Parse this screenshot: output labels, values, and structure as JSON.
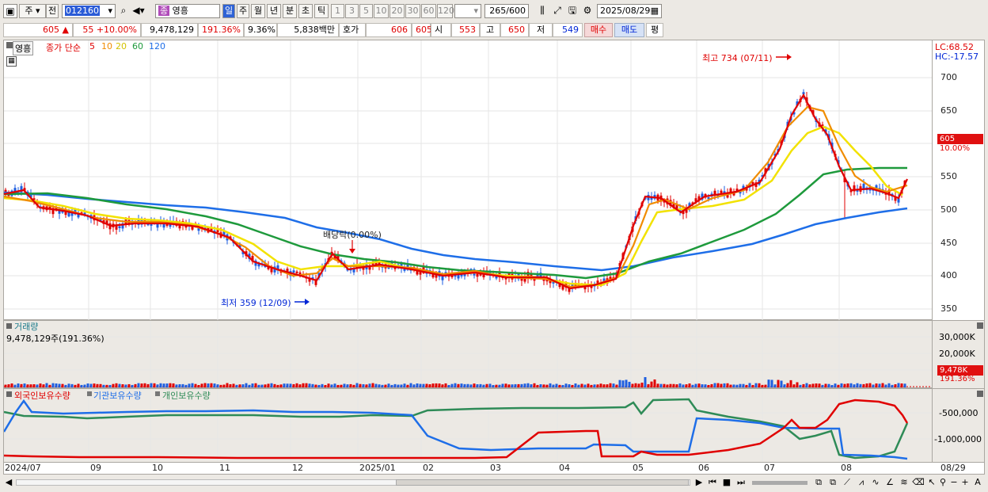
{
  "toolbar": {
    "period_main": "주",
    "all_label": "전",
    "code": "012160",
    "name_badge": "종",
    "name": "영흥",
    "periods": [
      "일",
      "주",
      "월",
      "년",
      "분",
      "초",
      "틱"
    ],
    "intervals": [
      "1",
      "3",
      "5",
      "10",
      "20",
      "30",
      "60",
      "120"
    ],
    "count": "265",
    "count_max": "/600",
    "date": "2025/08/29"
  },
  "quote": {
    "price": "605",
    "arrow": "▲",
    "change": "55",
    "change_pct": "+10.00%",
    "volume": "9,478,129",
    "vol_ratio": "191.36%",
    "turnover": "9.36%",
    "amount": "5,838백만",
    "bid_label": "호가",
    "ask": "606",
    "bid": "605",
    "open_label": "시",
    "open": "553",
    "high_label": "고",
    "high": "650",
    "low_label": "저",
    "low": "549",
    "buy_label": "매수",
    "sell_label": "매도",
    "eval_label": "평"
  },
  "price_panel": {
    "title_badge": "영흥",
    "legend_prefix": "종가 단순",
    "ma": [
      {
        "label": "5",
        "color": "#e00000"
      },
      {
        "label": "10",
        "color": "#f08c00"
      },
      {
        "label": "20",
        "color": "#f2e200"
      },
      {
        "label": "60",
        "color": "#1e9a3c"
      },
      {
        "label": "120",
        "color": "#1e6ee8"
      }
    ],
    "lc": "LC:68.52",
    "hc": "HC:-17.57",
    "high_note": "최고 734 (07/11)",
    "low_note": "최저 359 (12/09)",
    "dividend_note": "배당락(0.00%)",
    "last_price_tag": "605",
    "last_pct_tag": "10.00%",
    "y_ticks": [
      "700",
      "650",
      "600",
      "550",
      "500",
      "450",
      "400",
      "350"
    ]
  },
  "volume_panel": {
    "title": "거래량",
    "value": "9,478,129주(191.36%)",
    "y_ticks": [
      "30,000K",
      "20,000K",
      "10,000K"
    ],
    "tag_value": "9,478K",
    "tag_pct": "191.36%"
  },
  "holder_panel": {
    "legend": [
      {
        "label": "외국인보유수량",
        "color": "#e00000"
      },
      {
        "label": "기관보유수량",
        "color": "#1e6ee8"
      },
      {
        "label": "개인보유수량",
        "color": "#2e8b57"
      }
    ],
    "y_ticks": [
      "-500,000",
      "-1,000,000"
    ]
  },
  "x_axis": {
    "labels": [
      "2024/07",
      "09",
      "10",
      "11",
      "12",
      "2025/01",
      "02",
      "03",
      "04",
      "05",
      "06",
      "07",
      "08"
    ],
    "last_date": "08/29"
  },
  "chart_data": {
    "type": "line",
    "title": "영흥 012160",
    "x_labels": [
      "2024/07",
      "09",
      "10",
      "11",
      "12",
      "2025/01",
      "02",
      "03",
      "04",
      "05",
      "06",
      "07",
      "08",
      "08/29"
    ],
    "close_approx": [
      520,
      505,
      480,
      470,
      395,
      410,
      420,
      400,
      390,
      540,
      520,
      660,
      520,
      605
    ],
    "ma120_approx": [
      530,
      520,
      505,
      480,
      455,
      440,
      425,
      410,
      400,
      415,
      440,
      470,
      495,
      502
    ],
    "ylim": [
      340,
      720
    ],
    "high": {
      "value": 734,
      "date": "07/11"
    },
    "low": {
      "value": 359,
      "date": "12/09"
    },
    "ma_periods": [
      5,
      10,
      20,
      60,
      120
    ]
  }
}
